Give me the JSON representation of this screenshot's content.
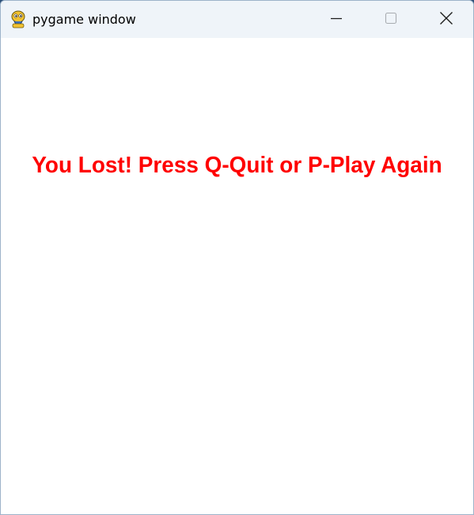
{
  "window": {
    "title": "pygame window",
    "app_icon": "pygame-snake-icon",
    "controls": {
      "minimize_icon": "minimize-icon",
      "maximize_icon": "maximize-icon",
      "close_icon": "close-icon"
    }
  },
  "game": {
    "message": "You Lost! Press Q-Quit or P-Play Again",
    "message_color": "#ff0000",
    "background_color": "#ffffff"
  }
}
